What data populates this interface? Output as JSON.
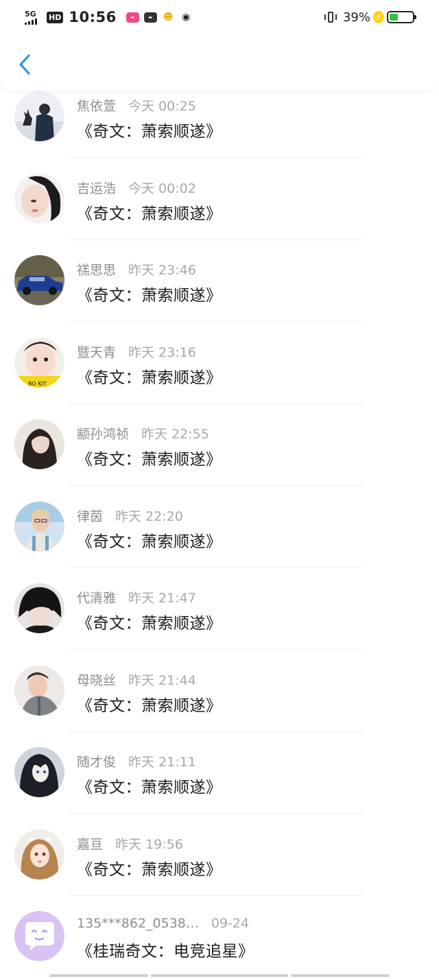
{
  "status_bar": {
    "network": "5G",
    "hd": "HD",
    "time": "10:56",
    "app_icons": [
      "lofter-icon",
      "youku-icon",
      "qq-icon",
      "weibo-icon"
    ],
    "battery_percent": "39%",
    "battery_level": 0.39,
    "colors": {
      "battery_fill": "#2fc244",
      "bolt": "#ffd21a"
    }
  },
  "header": {
    "back_icon": "chevron-left-icon",
    "accent": "#2e9bf0"
  },
  "messages": [
    {
      "name": "焦依萱",
      "time": "今天 00:25",
      "text": "《奇文：萧索顺遂》",
      "avatar": "silhouette-deer"
    },
    {
      "name": "吉运浩",
      "time": "今天 00:02",
      "text": "《奇文：萧索顺遂》",
      "avatar": "girl-portrait"
    },
    {
      "name": "禚思思",
      "time": "昨天 23:46",
      "text": "《奇文：萧索顺遂》",
      "avatar": "blue-car"
    },
    {
      "name": "暨天青",
      "time": "昨天 23:16",
      "text": "《奇文：萧索顺遂》",
      "avatar": "child-yellow"
    },
    {
      "name": "颛孙鸿祯",
      "time": "昨天 22:55",
      "text": "《奇文：萧索顺遂》",
      "avatar": "long-hair-girl"
    },
    {
      "name": "律茵",
      "time": "昨天 22:20",
      "text": "《奇文：萧索顺遂》",
      "avatar": "boy-beach"
    },
    {
      "name": "代清雅",
      "time": "昨天 21:47",
      "text": "《奇文：萧索顺遂》",
      "avatar": "dark-hair-boy"
    },
    {
      "name": "母晓丝",
      "time": "昨天 21:44",
      "text": "《奇文：萧索顺遂》",
      "avatar": "boy-gray-jacket"
    },
    {
      "name": "随才俊",
      "time": "昨天 21:11",
      "text": "《奇文：萧索顺遂》",
      "avatar": "anime-character"
    },
    {
      "name": "嘉亘",
      "time": "昨天 19:56",
      "text": "《奇文：萧索顺遂》",
      "avatar": "doll-portrait"
    },
    {
      "name": "135***862_0538…",
      "time": "09-24",
      "text": "《桂瑞奇文：电竞追星》",
      "avatar": "chat-bubble-icon"
    }
  ]
}
